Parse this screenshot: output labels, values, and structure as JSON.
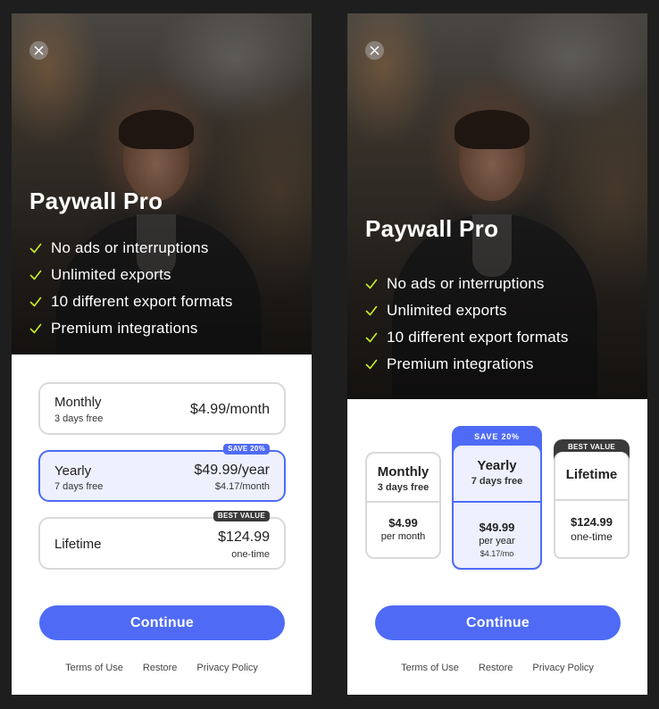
{
  "colors": {
    "accent": "#4f6bf5",
    "accent_light": "#eef0fd",
    "check": "#c8f020",
    "dark_tag": "#3a3a3a",
    "page_bg": "#1e1e1e"
  },
  "variants": [
    {
      "layout": "list",
      "hero": {
        "close_icon": "close-icon",
        "title": "Paywall Pro",
        "features": [
          "No ads or interruptions",
          "Unlimited exports",
          "10 different export formats",
          "Premium integrations"
        ]
      },
      "plans": [
        {
          "name": "Monthly",
          "trial": "3 days free",
          "price": "$4.99/month",
          "price_sub": "",
          "badge": "",
          "selected": false
        },
        {
          "name": "Yearly",
          "trial": "7 days free",
          "price": "$49.99/year",
          "price_sub": "$4.17/month",
          "badge": "SAVE 20%",
          "selected": true
        },
        {
          "name": "Lifetime",
          "trial": "",
          "price": "$124.99",
          "price_sub": "one-time",
          "badge": "BEST VALUE",
          "selected": false
        }
      ],
      "continue_label": "Continue",
      "footer_links": [
        "Terms of Use",
        "Restore",
        "Privacy Policy"
      ]
    },
    {
      "layout": "cards",
      "hero": {
        "close_icon": "close-icon",
        "title": "Paywall Pro",
        "features": [
          "No ads or interruptions",
          "Unlimited exports",
          "10 different export formats",
          "Premium integrations"
        ]
      },
      "plans": [
        {
          "name": "Monthly",
          "trial": "3 days free",
          "price": "$4.99",
          "price_sub": "per month",
          "price_sub2": "",
          "badge": "",
          "selected": false
        },
        {
          "name": "Yearly",
          "trial": "7 days free",
          "price": "$49.99",
          "price_sub": "per year",
          "price_sub2": "$4.17/mo",
          "badge": "SAVE 20%",
          "selected": true
        },
        {
          "name": "Lifetime",
          "trial": "",
          "price": "$124.99",
          "price_sub": "one-time",
          "price_sub2": "",
          "badge": "BEST VALUE",
          "selected": false
        }
      ],
      "continue_label": "Continue",
      "footer_links": [
        "Terms of Use",
        "Restore",
        "Privacy Policy"
      ]
    }
  ]
}
